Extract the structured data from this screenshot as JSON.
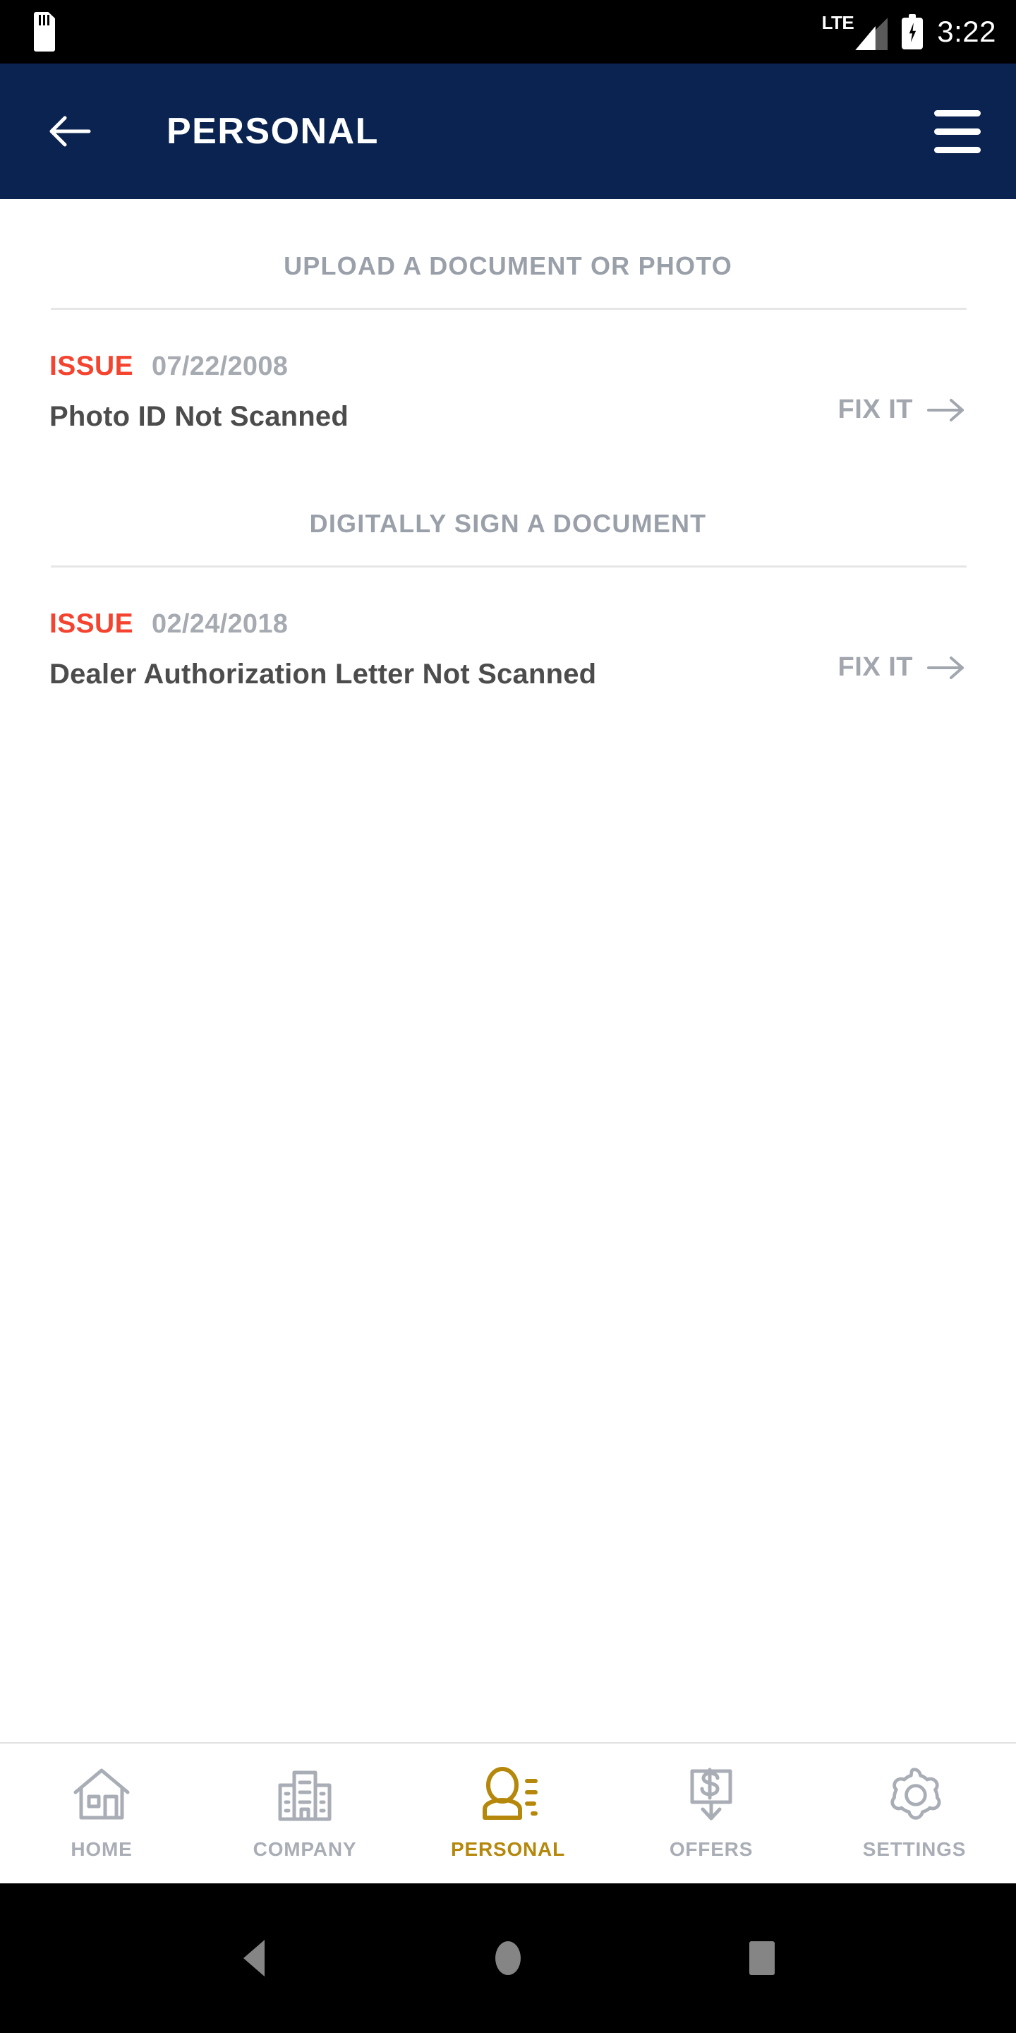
{
  "status_bar": {
    "sd_card_icon": "sd-card-icon",
    "network_label": "LTE",
    "signal_icon": "signal-bars-icon",
    "battery_icon": "battery-charging-icon",
    "time": "3:22"
  },
  "header": {
    "back_icon": "back-arrow-icon",
    "title": "PERSONAL",
    "menu_icon": "hamburger-menu-icon",
    "background_color": "#0a2350"
  },
  "sections": [
    {
      "header": "UPLOAD A DOCUMENT OR PHOTO",
      "issue": {
        "badge": "ISSUE",
        "badge_color": "#f4432f",
        "date": "07/22/2008",
        "title": "Photo ID Not Scanned",
        "action_label": "FIX IT",
        "action_icon": "arrow-right-icon"
      }
    },
    {
      "header": "DIGITALLY SIGN A DOCUMENT",
      "issue": {
        "badge": "ISSUE",
        "badge_color": "#f4432f",
        "date": "02/24/2018",
        "title": "Dealer Authorization Letter Not Scanned",
        "action_label": "FIX IT",
        "action_icon": "arrow-right-icon"
      }
    }
  ],
  "bottom_nav": {
    "active_color": "#b5880b",
    "inactive_color": "#a9adb5",
    "items": [
      {
        "label": "HOME",
        "icon": "home-icon",
        "active": false
      },
      {
        "label": "COMPANY",
        "icon": "building-icon",
        "active": false
      },
      {
        "label": "PERSONAL",
        "icon": "person-icon",
        "active": true
      },
      {
        "label": "OFFERS",
        "icon": "money-download-icon",
        "active": false
      },
      {
        "label": "SETTINGS",
        "icon": "gear-icon",
        "active": false
      }
    ]
  },
  "system_nav": {
    "back_icon": "system-back-icon",
    "home_icon": "system-home-icon",
    "recents_icon": "system-recents-icon"
  }
}
